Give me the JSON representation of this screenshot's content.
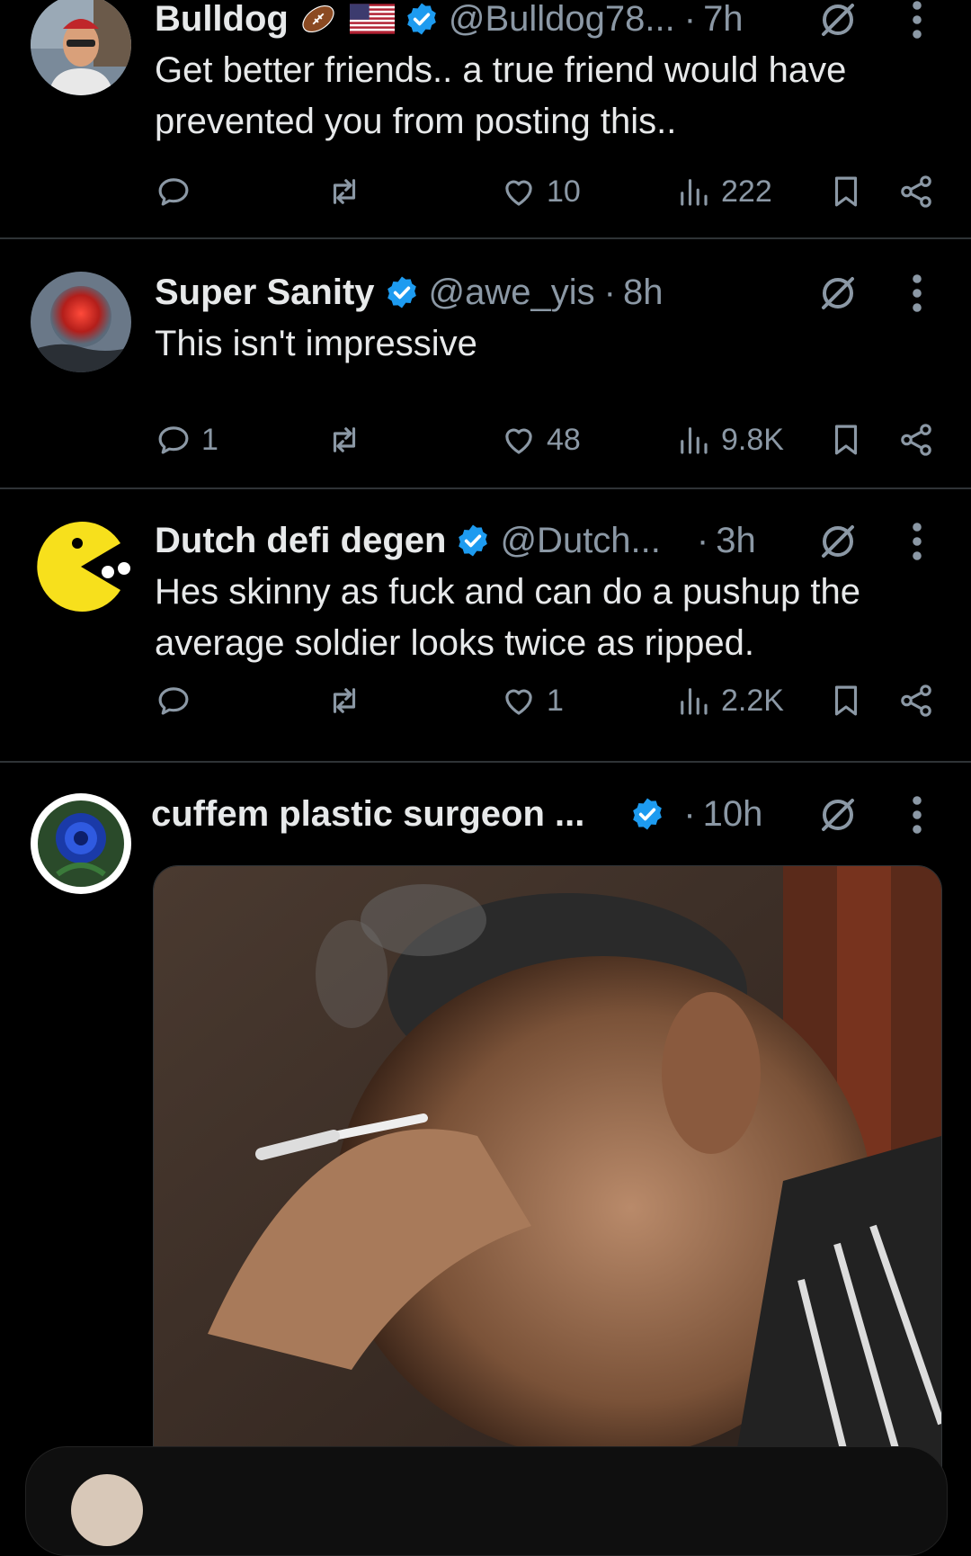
{
  "tweets": [
    {
      "name": "Bulldog",
      "handle": "@Bulldog78...",
      "time": "7h",
      "text": "Get better friends.. a true friend would have prevented you from posting this..",
      "reply_count": "",
      "likes": "10",
      "views": "222",
      "name_emojis": [
        "football-emoji",
        "us-flag-emoji"
      ]
    },
    {
      "name": "Super Sanity",
      "handle": "@awe_yis",
      "time": "8h",
      "text": "This isn't impressive",
      "reply_count": "1",
      "likes": "48",
      "views": "9.8K"
    },
    {
      "name": "Dutch defi degen",
      "handle": "@Dutch...",
      "time": "3h",
      "text": "Hes skinny as fuck and can do a pushup the average soldier looks twice as ripped.",
      "reply_count": "",
      "likes": "1",
      "views": "2.2K"
    },
    {
      "name": "cuffem plastic surgeon ...",
      "handle": "",
      "time": "10h",
      "text": "",
      "media": "gif-man-facepalm-smoking"
    }
  ],
  "colors": {
    "background": "#000000",
    "text_primary": "#e7e9ea",
    "text_secondary": "#8b98a5",
    "verified_blue": "#1d9bf0",
    "divider": "#2f3336"
  },
  "icons": [
    "reply-icon",
    "retweet-icon",
    "like-icon",
    "views-icon",
    "bookmark-icon",
    "share-icon",
    "grok-icon",
    "more-icon",
    "verified-badge-icon"
  ]
}
